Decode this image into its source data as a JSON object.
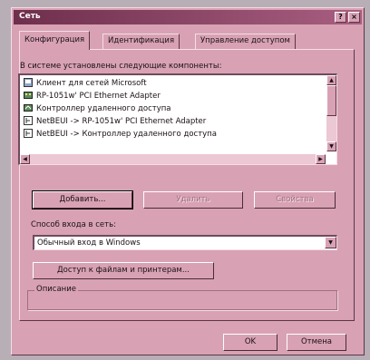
{
  "window": {
    "title": "Сеть"
  },
  "titlebar_buttons": {
    "help": "?",
    "close": "×"
  },
  "tabs": [
    {
      "label": "Конфигурация",
      "active": true
    },
    {
      "label": "Идентификация",
      "active": false
    },
    {
      "label": "Управление доступом",
      "active": false
    }
  ],
  "components_label": "В системе установлены следующие компоненты:",
  "components": [
    {
      "label": "Клиент для сетей Microsoft",
      "icon": "client-icon"
    },
    {
      "label": "RP-1051w' PCI Ethernet Adapter",
      "icon": "adapter-icon"
    },
    {
      "label": "Контроллер удаленного доступа",
      "icon": "dialup-adapter-icon"
    },
    {
      "label": "NetBEUI -> RP-1051w' PCI Ethernet Adapter",
      "icon": "protocol-icon"
    },
    {
      "label": "NetBEUI -> Контроллер удаленного доступа",
      "icon": "protocol-icon"
    }
  ],
  "buttons": {
    "add": "Добавить...",
    "remove": "Удалить",
    "properties": "Свойства",
    "file_sharing": "Доступ к файлам и принтерам...",
    "ok": "OK",
    "cancel": "Отмена"
  },
  "logon": {
    "label": "Способ входа в сеть:",
    "value": "Обычный вход в Windows"
  },
  "description": {
    "title": "Описание"
  },
  "colors": {
    "face": "#d8a2b4",
    "titlebar": "#6e2f4c",
    "disabled_text": "#a4727f"
  }
}
